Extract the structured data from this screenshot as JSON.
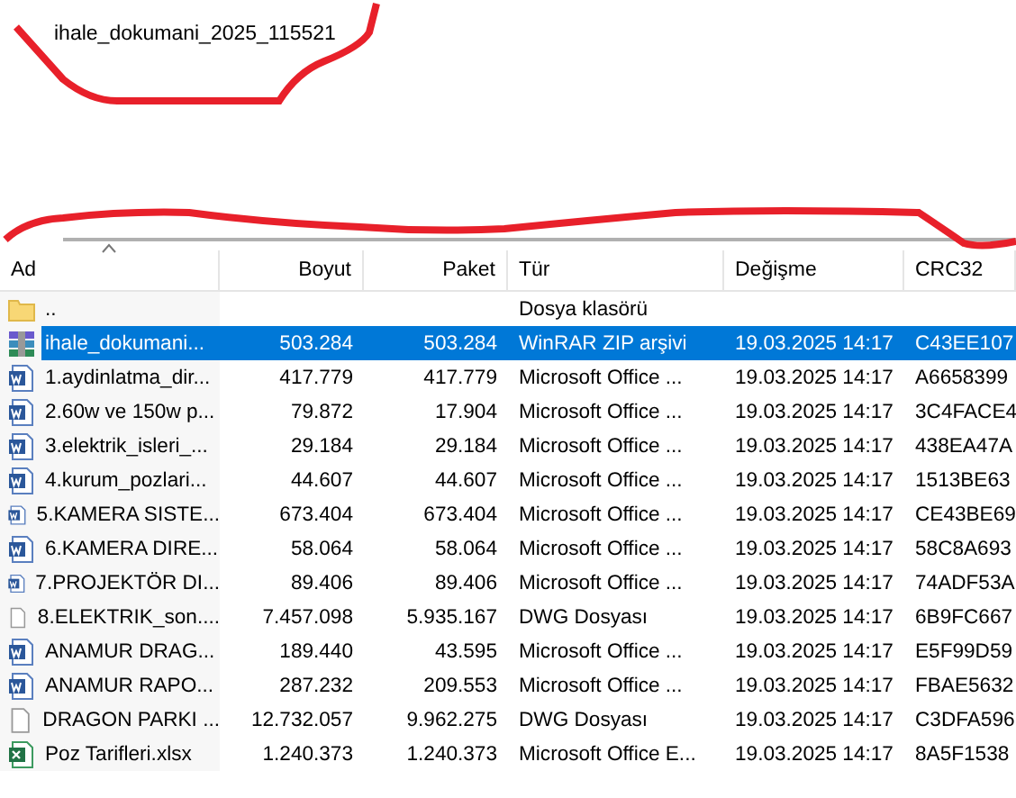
{
  "title": "ihale_dokumani_2025_115521",
  "columns": [
    {
      "label": "Ad",
      "sorted": true
    },
    {
      "label": "Boyut",
      "sorted": false
    },
    {
      "label": "Paket",
      "sorted": false
    },
    {
      "label": "Tür",
      "sorted": false
    },
    {
      "label": "Değişme",
      "sorted": false
    },
    {
      "label": "CRC32",
      "sorted": false
    }
  ],
  "rows": [
    {
      "kind": "folder",
      "selected": false,
      "cells": [
        "..",
        "",
        "",
        "Dosya klasörü",
        "",
        ""
      ]
    },
    {
      "kind": "archive",
      "selected": true,
      "cells": [
        "ihale_dokumani...",
        "503.284",
        "503.284",
        "WinRAR ZIP arşivi",
        "19.03.2025 14:17",
        "C43EE107"
      ]
    },
    {
      "kind": "word",
      "selected": false,
      "cells": [
        "1.aydinlatma_dir...",
        "417.779",
        "417.779",
        "Microsoft Office ...",
        "19.03.2025 14:17",
        "A6658399"
      ]
    },
    {
      "kind": "word",
      "selected": false,
      "cells": [
        "2.60w ve 150w p...",
        "79.872",
        "17.904",
        "Microsoft Office ...",
        "19.03.2025 14:17",
        "3C4FACE4"
      ]
    },
    {
      "kind": "word",
      "selected": false,
      "cells": [
        "3.elektrik_isleri_...",
        "29.184",
        "29.184",
        "Microsoft Office ...",
        "19.03.2025 14:17",
        "438EA47A"
      ]
    },
    {
      "kind": "word",
      "selected": false,
      "cells": [
        "4.kurum_pozlari...",
        "44.607",
        "44.607",
        "Microsoft Office ...",
        "19.03.2025 14:17",
        "1513BE63"
      ]
    },
    {
      "kind": "word",
      "selected": false,
      "cells": [
        "5.KAMERA SISTE...",
        "673.404",
        "673.404",
        "Microsoft Office ...",
        "19.03.2025 14:17",
        "CE43BE69"
      ]
    },
    {
      "kind": "word",
      "selected": false,
      "cells": [
        "6.KAMERA DIRE...",
        "58.064",
        "58.064",
        "Microsoft Office ...",
        "19.03.2025 14:17",
        "58C8A693"
      ]
    },
    {
      "kind": "word",
      "selected": false,
      "cells": [
        "7.PROJEKTÖR DI...",
        "89.406",
        "89.406",
        "Microsoft Office ...",
        "19.03.2025 14:17",
        "74ADF53A"
      ]
    },
    {
      "kind": "file",
      "selected": false,
      "cells": [
        "8.ELEKTRIK_son....",
        "7.457.098",
        "5.935.167",
        "DWG Dosyası",
        "19.03.2025 14:17",
        "6B9FC667"
      ]
    },
    {
      "kind": "word",
      "selected": false,
      "cells": [
        "ANAMUR DRAG...",
        "189.440",
        "43.595",
        "Microsoft Office ...",
        "19.03.2025 14:17",
        "E5F99D59"
      ]
    },
    {
      "kind": "word",
      "selected": false,
      "cells": [
        "ANAMUR RAPO...",
        "287.232",
        "209.553",
        "Microsoft Office ...",
        "19.03.2025 14:17",
        "FBAE5632"
      ]
    },
    {
      "kind": "file",
      "selected": false,
      "cells": [
        "DRAGON PARKI ...",
        "12.732.057",
        "9.962.275",
        "DWG Dosyası",
        "19.03.2025 14:17",
        "C3DFA596"
      ]
    },
    {
      "kind": "excel",
      "selected": false,
      "cells": [
        "Poz Tarifleri.xlsx",
        "1.240.373",
        "1.240.373",
        "Microsoft Office E...",
        "19.03.2025 14:17",
        "8A5F1538"
      ]
    }
  ]
}
